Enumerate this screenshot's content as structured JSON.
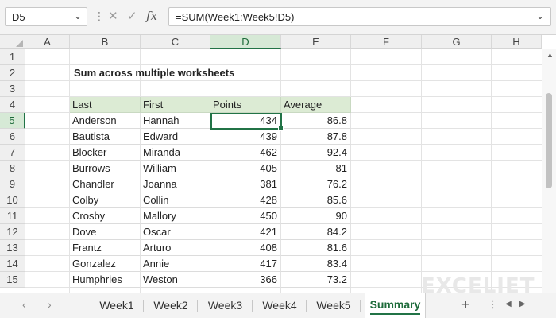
{
  "formula_bar": {
    "name_box": "D5",
    "name_box_caret": "⌄",
    "dots": "⋮",
    "cancel_icon": "✕",
    "enter_icon": "✓",
    "fx_label": "fx",
    "formula": "=SUM(Week1:Week5!D5)",
    "formula_caret": "⌄"
  },
  "columns": [
    "A",
    "B",
    "C",
    "D",
    "E",
    "F",
    "G",
    "H"
  ],
  "rows": [
    "1",
    "2",
    "3",
    "4",
    "5",
    "6",
    "7",
    "8",
    "9",
    "10",
    "11",
    "12",
    "13",
    "14",
    "15"
  ],
  "selected_column": "D",
  "selected_row": "5",
  "title": "Sum across multiple worksheets",
  "table": {
    "headers": [
      "Last",
      "First",
      "Points",
      "Average"
    ],
    "rows": [
      [
        "Anderson",
        "Hannah",
        "434",
        "86.8"
      ],
      [
        "Bautista",
        "Edward",
        "439",
        "87.8"
      ],
      [
        "Blocker",
        "Miranda",
        "462",
        "92.4"
      ],
      [
        "Burrows",
        "William",
        "405",
        "81"
      ],
      [
        "Chandler",
        "Joanna",
        "381",
        "76.2"
      ],
      [
        "Colby",
        "Collin",
        "428",
        "85.6"
      ],
      [
        "Crosby",
        "Mallory",
        "450",
        "90"
      ],
      [
        "Dove",
        "Oscar",
        "421",
        "84.2"
      ],
      [
        "Frantz",
        "Arturo",
        "408",
        "81.6"
      ],
      [
        "Gonzalez",
        "Annie",
        "417",
        "83.4"
      ],
      [
        "Humphries",
        "Weston",
        "366",
        "73.2"
      ]
    ]
  },
  "tabs": [
    "Week1",
    "Week2",
    "Week3",
    "Week4",
    "Week5",
    "Summary"
  ],
  "active_tab": "Summary",
  "tab_nav": {
    "prev": "‹",
    "next": "›",
    "add": "+",
    "more": "⋮",
    "scroll_left": "◀",
    "scroll_right": "▶",
    "scroll_up": "▲"
  },
  "logo": "EXCELJET",
  "colors": {
    "accent": "#217346",
    "header_fill": "#dcebd4",
    "selected_header": "#d6e9d6"
  }
}
